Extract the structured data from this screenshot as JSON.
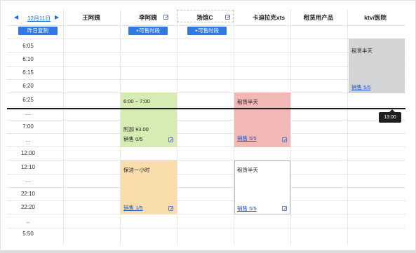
{
  "header": {
    "prev_icon": "triangle-left-icon",
    "next_icon": "triangle-right-icon",
    "date": "12月11日",
    "copy_button": "昨日复制",
    "columns": [
      "王阿姨",
      "李阿姨",
      "场馆C",
      "卡迪拉克xts",
      "租赁用产品",
      "ktv/医院"
    ],
    "add_slot_label": "+可售时段"
  },
  "times": [
    "6:05",
    "6:10",
    "6:15",
    "6:20",
    "6:25",
    "...",
    "7:00",
    "...",
    "12:00",
    "12:10",
    "...",
    "22:10",
    "22:20",
    "..",
    "5:50"
  ],
  "blocks": {
    "li_green": {
      "time": "6:00 ~ 7:00",
      "price": "附加 ¥3.00",
      "sales": "销售 0/5"
    },
    "li_orange": {
      "title": "保洁一小时",
      "sales": "销售 1/5"
    },
    "cadillac_red": {
      "title": "租赁半天",
      "sales": "销售 5/5"
    },
    "cadillac_white": {
      "title": "租赁半天",
      "sales": "销售 5/5"
    },
    "ktv_gray": {
      "title": "租赁半天",
      "sales": "销售 5/5"
    }
  },
  "now_marker": "13:00",
  "colors": {
    "accent": "#2f7ae5",
    "green_block": "#d6ecb2",
    "orange_block": "#f9deab",
    "red_block": "#f2b8b5",
    "gray_block": "#d3d4d6"
  }
}
